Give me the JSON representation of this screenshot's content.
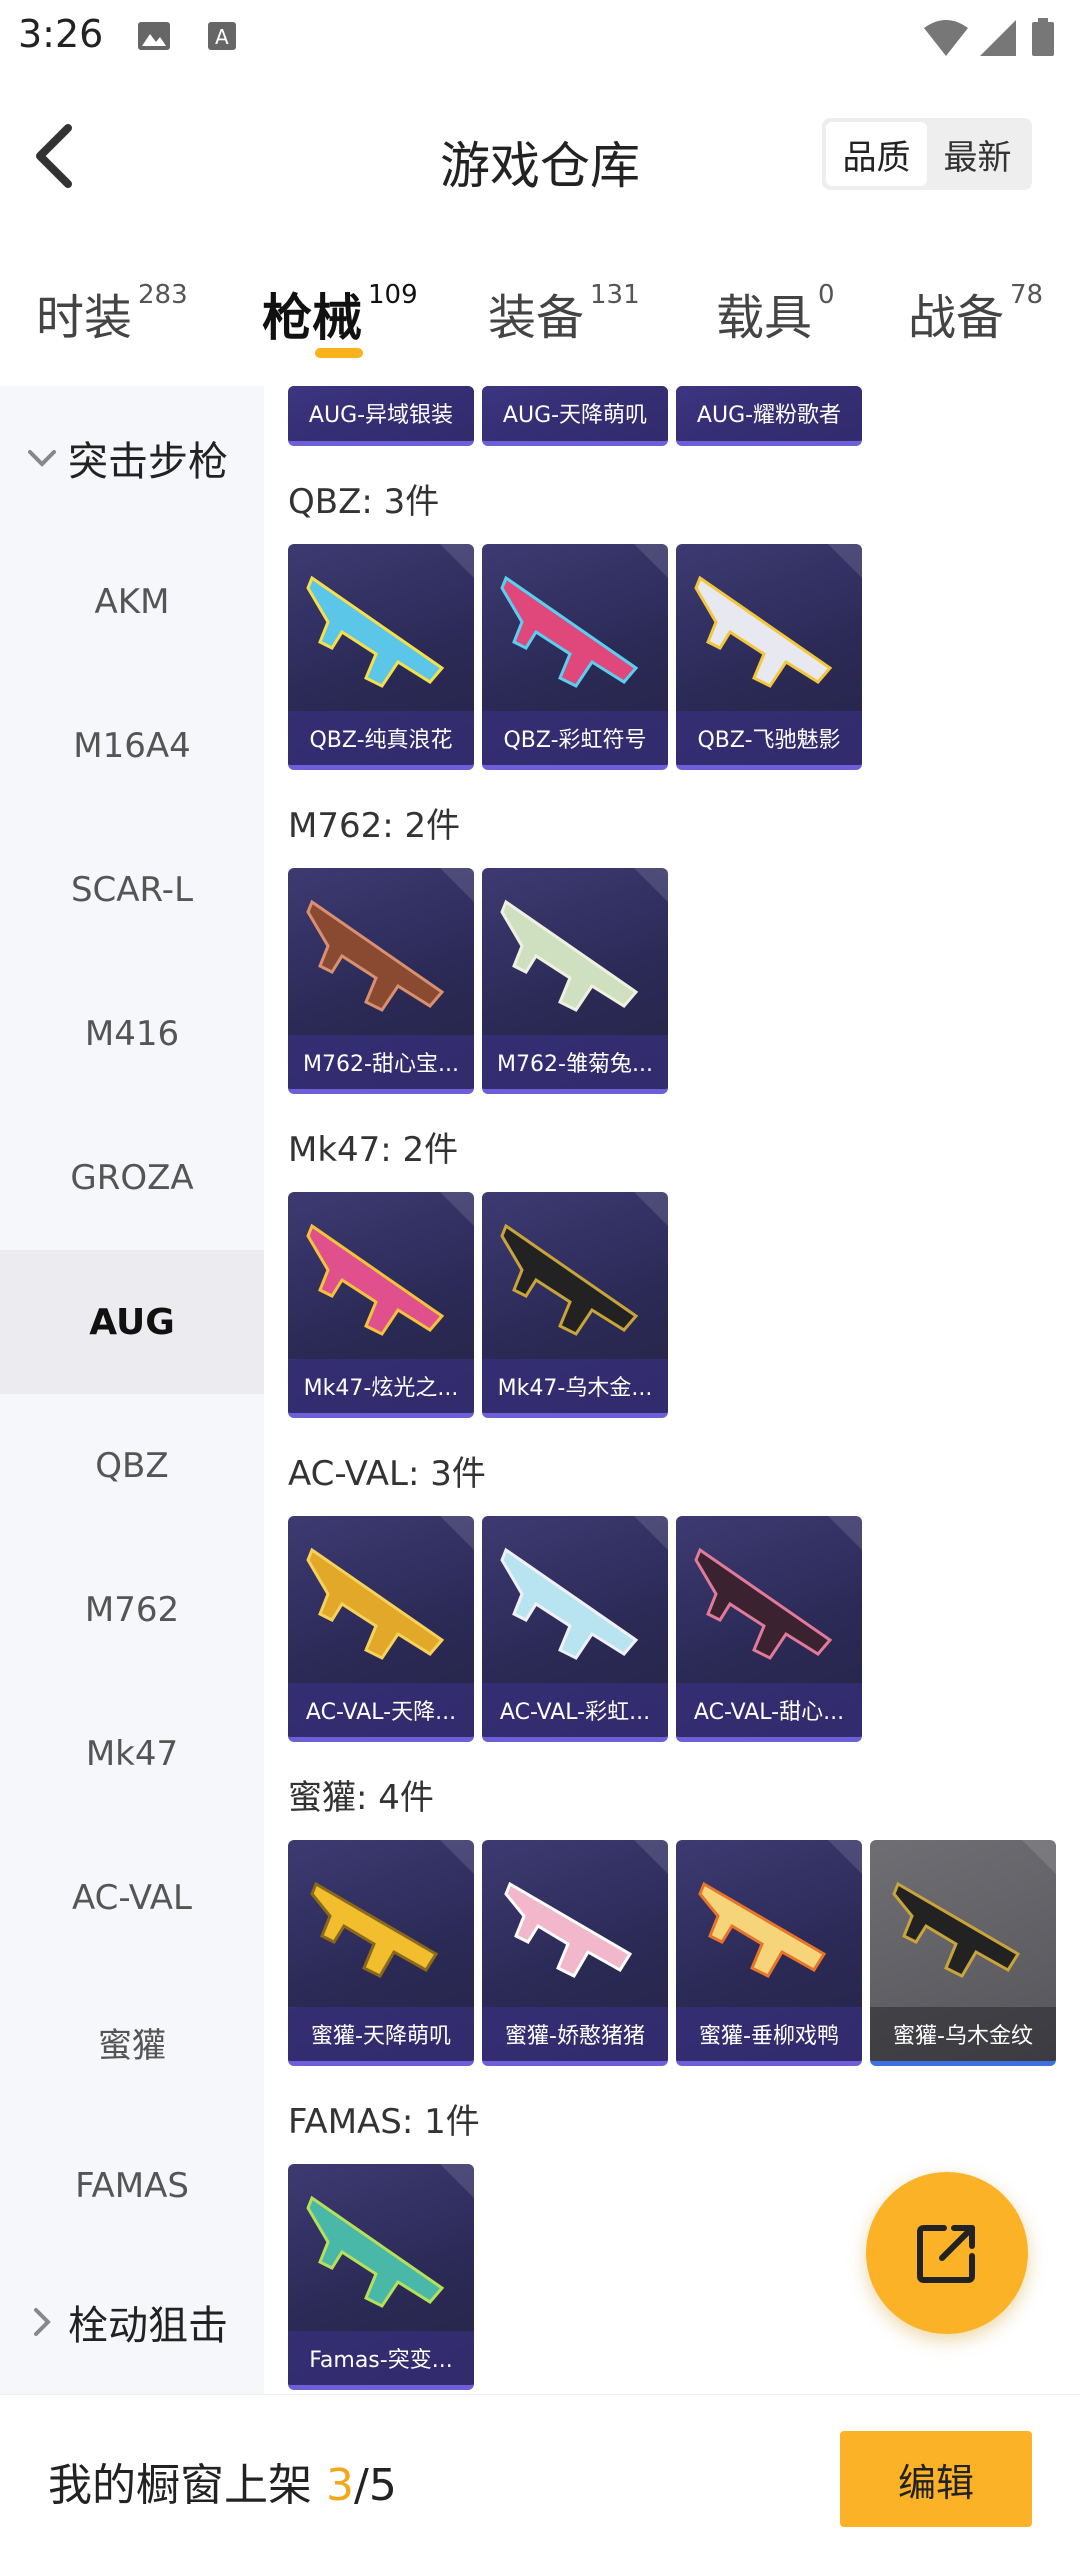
{
  "status": {
    "time": "3:26"
  },
  "header": {
    "title": "游戏仓库",
    "sort_quality": "品质",
    "sort_newest": "最新"
  },
  "categories": [
    {
      "label": "时装",
      "count": "283"
    },
    {
      "label": "枪械",
      "count": "109"
    },
    {
      "label": "装备",
      "count": "131"
    },
    {
      "label": "载具",
      "count": "0"
    },
    {
      "label": "战备",
      "count": "78"
    }
  ],
  "sidebar": {
    "group_assault": "突击步枪",
    "items": [
      "AKM",
      "M16A4",
      "SCAR-L",
      "M416",
      "GROZA",
      "AUG",
      "QBZ",
      "M762",
      "Mk47",
      "AC-VAL",
      "蜜獾",
      "FAMAS"
    ],
    "group_bolt": "栓动狙击"
  },
  "sections": {
    "aug": {
      "cards": [
        "AUG-异域银装",
        "AUG-天降萌叽",
        "AUG-耀粉歌者"
      ]
    },
    "qbz": {
      "title": "QBZ: 3件",
      "cards": [
        "QBZ-纯真浪花",
        "QBZ-彩虹符号",
        "QBZ-飞驰魅影"
      ]
    },
    "m762": {
      "title": "M762: 2件",
      "cards": [
        "M762-甜心宝...",
        "M762-雏菊兔..."
      ]
    },
    "mk47": {
      "title": "Mk47: 2件",
      "cards": [
        "Mk47-炫光之...",
        "Mk47-乌木金..."
      ]
    },
    "acval": {
      "title": "AC-VAL: 3件",
      "cards": [
        "AC-VAL-天降...",
        "AC-VAL-彩虹...",
        "AC-VAL-甜心..."
      ]
    },
    "honeybadger": {
      "title": "蜜獾: 4件",
      "cards": [
        "蜜獾-天降萌叽",
        "蜜獾-娇憨猪猪",
        "蜜獾-垂柳戏鸭",
        "蜜獾-乌木金纹"
      ]
    },
    "famas": {
      "title": "FAMAS: 1件",
      "cards": [
        "Famas-突变..."
      ]
    }
  },
  "bottom": {
    "shelf_prefix": "我的橱窗上架 ",
    "shelf_current": "3",
    "shelf_total": "/5",
    "edit_label": "编辑"
  },
  "colors": {
    "accent": "#fbb226",
    "card_bg": "#2b2a56",
    "card_border": "#6d5fd8"
  }
}
